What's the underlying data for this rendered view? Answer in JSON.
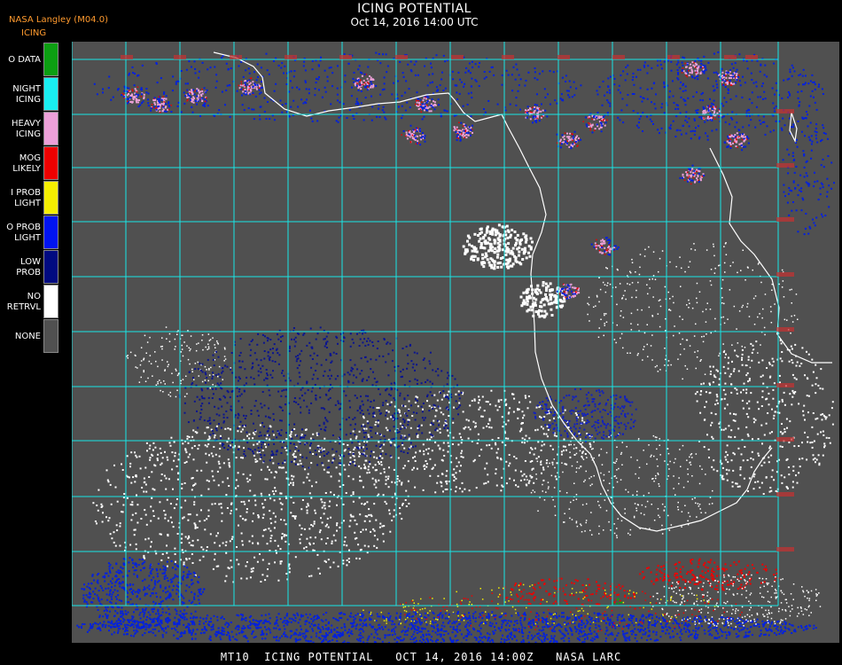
{
  "header": {
    "credit": "NASA Langley (M04.0)",
    "title": "ICING POTENTIAL",
    "subtitle": "Oct 14, 2016 14:00 UTC",
    "legend_title": "ICING"
  },
  "legend": [
    {
      "line1": "O DATA",
      "line2": "",
      "color": "#0c9f12"
    },
    {
      "line1": "NIGHT",
      "line2": "ICING",
      "color": "#19eef0"
    },
    {
      "line1": "HEAVY",
      "line2": "ICING",
      "color": "#eca0d8"
    },
    {
      "line1": "MOG",
      "line2": "LIKELY",
      "color": "#ee0000"
    },
    {
      "line1": "I PROB",
      "line2": "LIGHT",
      "color": "#f4ee00"
    },
    {
      "line1": "O PROB",
      "line2": "LIGHT",
      "color": "#0014f0"
    },
    {
      "line1": "LOW",
      "line2": "PROB",
      "color": "#000a80"
    },
    {
      "line1": "NO",
      "line2": "RETRVL",
      "color": "#ffffff"
    },
    {
      "line1": "NONE",
      "line2": "",
      "color": "#505050"
    }
  ],
  "map": {
    "background_color": "#505050",
    "grid_color": "#19e6e6",
    "coast_color": "#ffffff",
    "grid_label_color": "#c83030"
  },
  "footer": {
    "text": "MT10  ICING POTENTIAL   OCT 14, 2016 14:00Z   NASA LARC"
  }
}
